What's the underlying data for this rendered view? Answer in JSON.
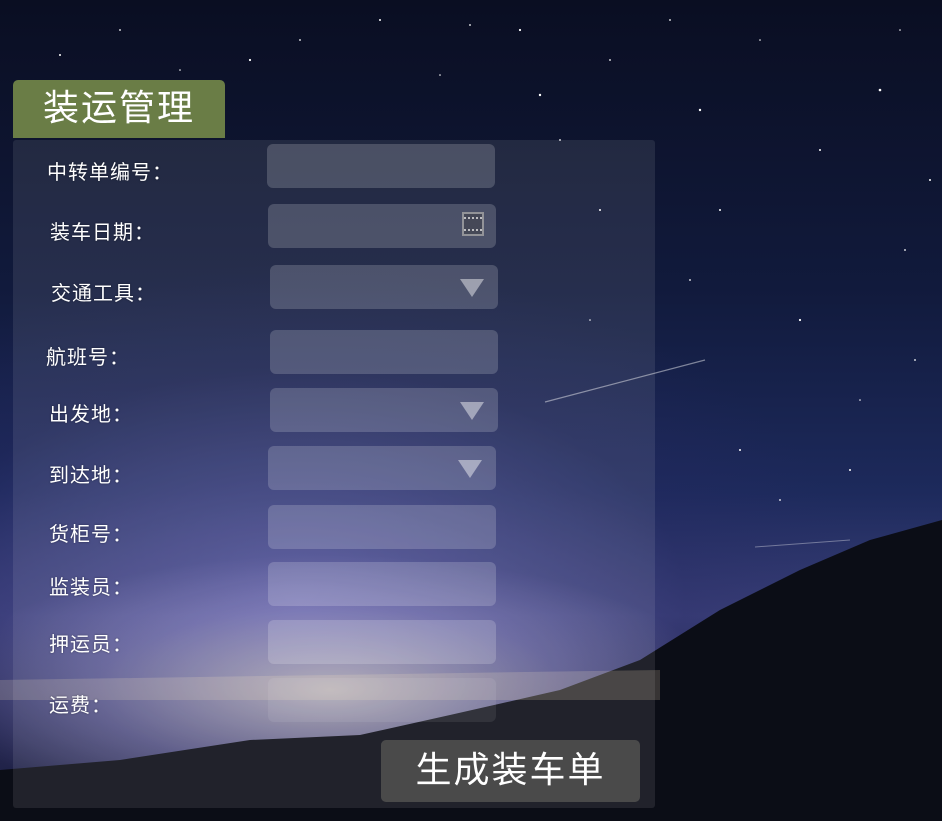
{
  "form": {
    "title": "装运管理",
    "fields": [
      {
        "label": "中转单编号：",
        "type": "text",
        "value": ""
      },
      {
        "label": "装车日期：",
        "type": "date",
        "value": ""
      },
      {
        "label": "交通工具：",
        "type": "select",
        "value": ""
      },
      {
        "label": "航班号：",
        "type": "text",
        "value": ""
      },
      {
        "label": "出发地：",
        "type": "select",
        "value": ""
      },
      {
        "label": "到达地：",
        "type": "select",
        "value": ""
      },
      {
        "label": "货柜号：",
        "type": "text",
        "value": ""
      },
      {
        "label": "监装员：",
        "type": "text",
        "value": ""
      },
      {
        "label": "押运员：",
        "type": "text",
        "value": ""
      },
      {
        "label": "运费：",
        "type": "text",
        "value": ""
      }
    ],
    "submit_label": "生成装车单"
  },
  "colors": {
    "title_bg": "#6a7d46",
    "button_bg": "#4a4a4a",
    "text": "#ffffff"
  },
  "icons": {
    "date": "calendar-icon",
    "select": "dropdown-arrow-icon"
  }
}
